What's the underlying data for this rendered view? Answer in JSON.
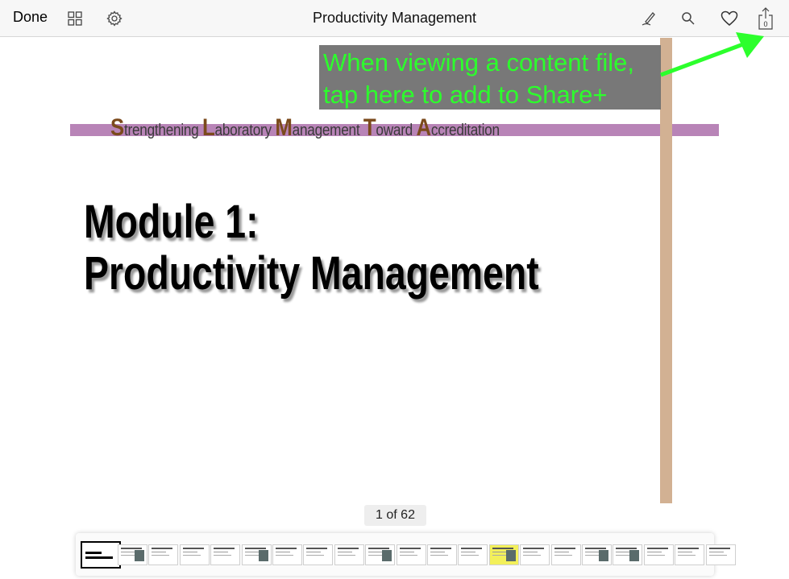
{
  "toolbar": {
    "done_label": "Done",
    "title": "Productivity Management",
    "share_count": "0"
  },
  "slide": {
    "subtitle_letters": [
      "S",
      "L",
      "M",
      "T",
      "A"
    ],
    "subtitle_rest": [
      "trengthening ",
      "aboratory ",
      "anagement ",
      "oward ",
      "ccreditation"
    ],
    "heading_line1": "Module 1:",
    "heading_line2": "Productivity Management"
  },
  "tooltip": {
    "line1": "When viewing a content file,",
    "line2": "tap here to add to Share+"
  },
  "page_indicator": "1 of 62",
  "thumbnails": {
    "visible_count": 21,
    "selected_index": 0
  },
  "colors": {
    "tooltip_text": "#2cff2c",
    "arrow": "#2cff2c",
    "vertical_bar": "#d2b193",
    "horizontal_bar": "#b884b7",
    "subtitle_initial": "#7b4a1c"
  }
}
